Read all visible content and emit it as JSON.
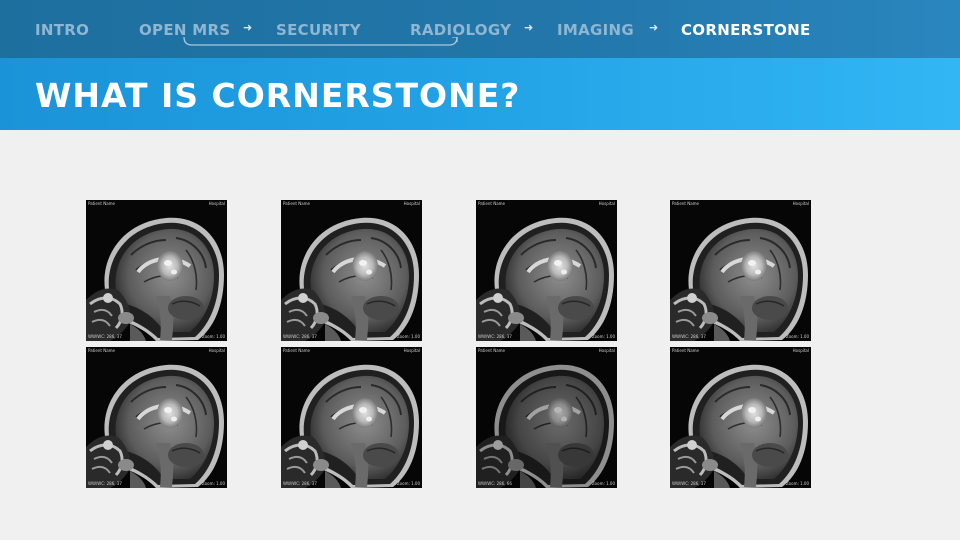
{
  "nav": {
    "items": [
      {
        "label": "INTRO",
        "active": false
      },
      {
        "label": "OPEN MRS",
        "active": false
      },
      {
        "label": "SECURITY",
        "active": false
      },
      {
        "label": "RADIOLOGY",
        "active": false
      },
      {
        "label": "IMAGING",
        "active": false
      },
      {
        "label": "CORNERSTONE",
        "active": true
      }
    ],
    "arrow_glyph": "➜"
  },
  "page": {
    "title": "WHAT IS CORNERSTONE?"
  },
  "images": [
    {
      "id": 1,
      "tl": "Patient Name",
      "tr": "Hospital",
      "bl": "WW/WC: 286, 37",
      "br": "Zoom: 1.00"
    },
    {
      "id": 2,
      "tl": "Patient Name",
      "tr": "Hospital",
      "bl": "WW/WC: 286, 37",
      "br": "Zoom: 1.00"
    },
    {
      "id": 3,
      "tl": "Patient Name",
      "tr": "Hospital",
      "bl": "WW/WC: 286, 37",
      "br": "Zoom: 1.00"
    },
    {
      "id": 4,
      "tl": "Patient Name",
      "tr": "Hospital",
      "bl": "WW/WC: 286, 37",
      "br": "Zoom: 1.00"
    },
    {
      "id": 5,
      "tl": "Patient Name",
      "tr": "Hospital",
      "bl": "WW/WC: 286, 37",
      "br": "Zoom: 1.00"
    },
    {
      "id": 6,
      "tl": "Patient Name",
      "tr": "Hospital",
      "bl": "WW/WC: 286, 37",
      "br": "Zoom: 1.00"
    },
    {
      "id": 7,
      "tl": "Patient Name",
      "tr": "Hospital",
      "bl": "WW/WC: 286, 66",
      "br": "Zoom: 1.00"
    },
    {
      "id": 8,
      "tl": "Patient Name",
      "tr": "Hospital",
      "bl": "WW/WC: 286, 37",
      "br": "Zoom: 1.00"
    }
  ],
  "colors": {
    "nav_bg": "#2277ab",
    "title_bg": "#22a3e6",
    "nav_inactive": "#8fb6d2",
    "nav_active": "#ffffff",
    "page_bg": "#f0f0f0"
  }
}
